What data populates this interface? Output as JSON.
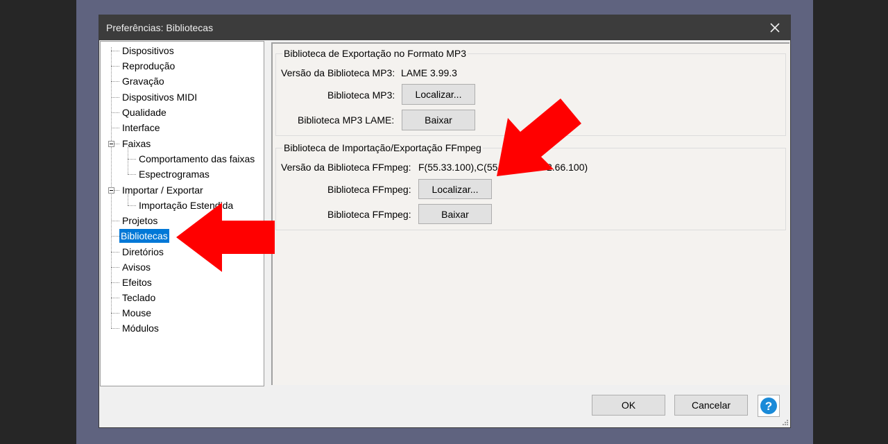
{
  "window": {
    "title": "Preferências: Bibliotecas"
  },
  "tree": {
    "items": [
      {
        "label": "Dispositivos"
      },
      {
        "label": "Reprodução"
      },
      {
        "label": "Gravação"
      },
      {
        "label": "Dispositivos MIDI"
      },
      {
        "label": "Qualidade"
      },
      {
        "label": "Interface"
      },
      {
        "label": "Faixas"
      },
      {
        "label": "Comportamento das faixas"
      },
      {
        "label": "Espectrogramas"
      },
      {
        "label": "Importar / Exportar"
      },
      {
        "label": "Importação Estendida"
      },
      {
        "label": "Projetos"
      },
      {
        "label": "Bibliotecas",
        "selected": true
      },
      {
        "label": "Diretórios"
      },
      {
        "label": "Avisos"
      },
      {
        "label": "Efeitos"
      },
      {
        "label": "Teclado"
      },
      {
        "label": "Mouse"
      },
      {
        "label": "Módulos"
      }
    ]
  },
  "mp3": {
    "group_title": "Biblioteca de Exportação no Formato MP3",
    "version_label": "Versão da Biblioteca MP3:",
    "version_value": "LAME 3.99.3",
    "lib_label": "Biblioteca MP3:",
    "locate_button": "Localizar...",
    "lame_label": "Biblioteca MP3 LAME:",
    "download_button": "Baixar"
  },
  "ffmpeg": {
    "group_title": "Biblioteca de Importação/Exportação FFmpeg",
    "version_label": "Versão da Biblioteca FFmpeg:",
    "version_value_a": "F(55.33.100),C(55.5",
    "version_value_b": "2.66.100)",
    "lib_label": "Biblioteca FFmpeg:",
    "locate_button": "Localizar...",
    "download_label": "Biblioteca FFmpeg:",
    "download_button": "Baixar"
  },
  "footer": {
    "ok": "OK",
    "cancel": "Cancelar",
    "help_glyph": "?"
  },
  "colors": {
    "selection": "#0078d7",
    "arrow": "#ff0000",
    "titlebar": "#3c3c3c",
    "help": "#1a8ad8"
  },
  "icons": {
    "close": "close-icon",
    "help": "help-icon",
    "arrow": "red-arrow-annotation"
  }
}
